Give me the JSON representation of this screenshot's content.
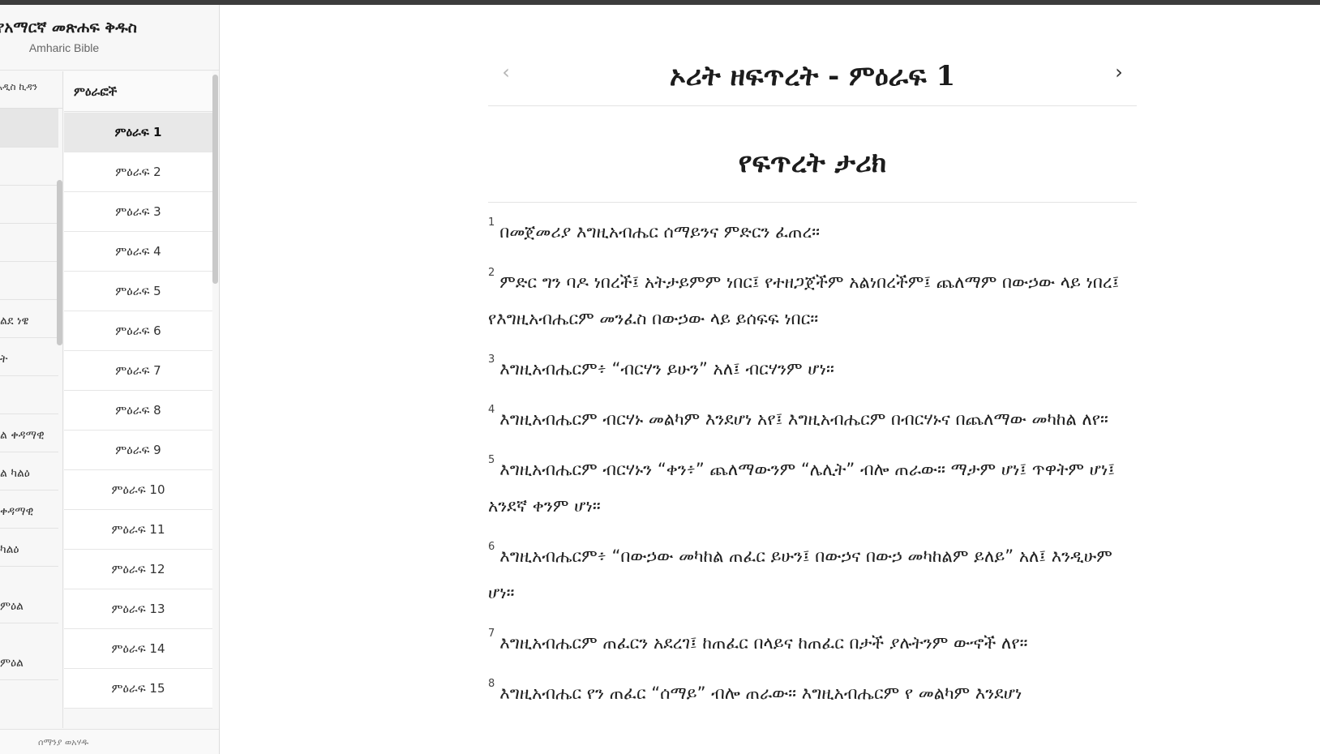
{
  "app": {
    "title": "የአማርኛ መጽሐፍ ቅዱስ",
    "subtitle": "Amharic Bible",
    "footer_text": "ሰማንያ ወአሃዱ"
  },
  "books_panel": {
    "tab_label": "አዲስ ኪዳን",
    "items": [
      "",
      "",
      "",
      "",
      "",
      "ልደ ነዌ",
      "ት",
      "",
      "ል ቀዳማዊ",
      "ል ካልዕ",
      "ቀዳማዊ",
      "ካልዕ",
      "ምዕል",
      "ምዕል"
    ]
  },
  "chapters_panel": {
    "header": "ምዕራፎች",
    "items": [
      "ምዕራፍ 1",
      "ምዕራፍ 2",
      "ምዕራፍ 3",
      "ምዕራፍ 4",
      "ምዕራፍ 5",
      "ምዕራፍ 6",
      "ምዕራፍ 7",
      "ምዕራፍ 8",
      "ምዕራፍ 9",
      "ምዕራፍ 10",
      "ምዕራፍ 11",
      "ምዕራፍ 12",
      "ምዕራፍ 13",
      "ምዕራፍ 14",
      "ምዕራፍ 15"
    ],
    "selected_index": 0
  },
  "reader": {
    "chapter_title": "ኦሪት ዘፍጥረት - ምዕራፍ 1",
    "prev_icon": "‹",
    "next_icon": "›",
    "section_title": "የፍጥረት ታሪክ",
    "verses": [
      {
        "num": "1",
        "text": "በመጀመሪያ እግዚአብሔር ሰማይንና ምድርን ፈጠረ።"
      },
      {
        "num": "2",
        "text": "ምድር ግን ባዶ ነበረች፤ አትታይምም ነበር፤ የተዘጋጀችም አልነበረችም፤ ጨለማም በውኃው ላይ ነበረ፤ የእግዚአብሔርም መንፈስ በውኃው ላይ ይሰፍፍ ነበር።"
      },
      {
        "num": "3",
        "text": "እግዚአብሔርም፥ “ብርሃን ይሁን” አለ፤ ብርሃንም ሆነ።"
      },
      {
        "num": "4",
        "text": "እግዚአብሔርም ብርሃኑ መልካም እንደሆነ አየ፤ እግዚአብሔርም በብርሃኑና በጨለማው መካከል ለየ።"
      },
      {
        "num": "5",
        "text": "እግዚአብሔርም ብርሃኑን “ቀን፥” ጨለማውንም “ሌሊት” ብሎ ጠራው። ማታም ሆነ፤ ጥዋትም ሆነ፤ አንደኛ ቀንም ሆነ።"
      },
      {
        "num": "6",
        "text": "እግዚአብሔርም፥ “በውኃው መካከል ጠፈር ይሁን፤ በውኃና በውኃ መካከልም ይለይ” አለ፤ እንዲሁም ሆነ።"
      },
      {
        "num": "7",
        "text": "እግዚአብሔርም ጠፈርን አደረገ፤ ከጠፈር በላይና ከጠፈር በታች ያሉትንም ውኆች ለየ።"
      },
      {
        "num": "8",
        "text": "እግዚአብሔር የን ጠፈር “ሰማይ” ብሎ ጠራው። እግዚአብሔርም የ መልካም እንደሆነ"
      }
    ]
  },
  "colors": {
    "topbar": "#3c3c3c",
    "sidebar_bg": "#f7f7f7",
    "selected_bg": "#e8e8e8",
    "text": "#222222"
  }
}
